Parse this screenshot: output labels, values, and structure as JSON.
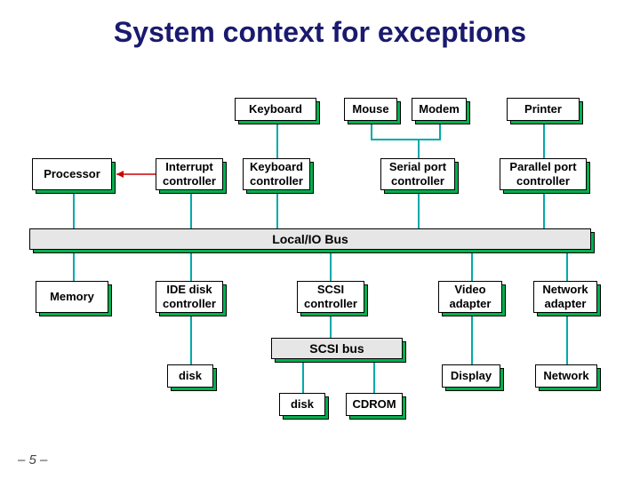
{
  "title": "System context for exceptions",
  "footer": "– 5 –",
  "boxes": {
    "keyboard": "Keyboard",
    "mouse": "Mouse",
    "modem": "Modem",
    "printer": "Printer",
    "processor": "Processor",
    "interrupt_ctrl": "Interrupt\ncontroller",
    "keyboard_ctrl": "Keyboard\ncontroller",
    "serial_ctrl": "Serial port\ncontroller",
    "parallel_ctrl": "Parallel port\ncontroller",
    "memory": "Memory",
    "ide_ctrl": "IDE disk\ncontroller",
    "scsi_ctrl": "SCSI\ncontroller",
    "video_adapter": "Video\nadapter",
    "network_adapter": "Network\nadapter",
    "disk1": "disk",
    "disk2": "disk",
    "cdrom": "CDROM",
    "display": "Display",
    "network": "Network"
  },
  "buses": {
    "local_io": "Local/IO Bus",
    "scsi": "SCSI bus"
  }
}
